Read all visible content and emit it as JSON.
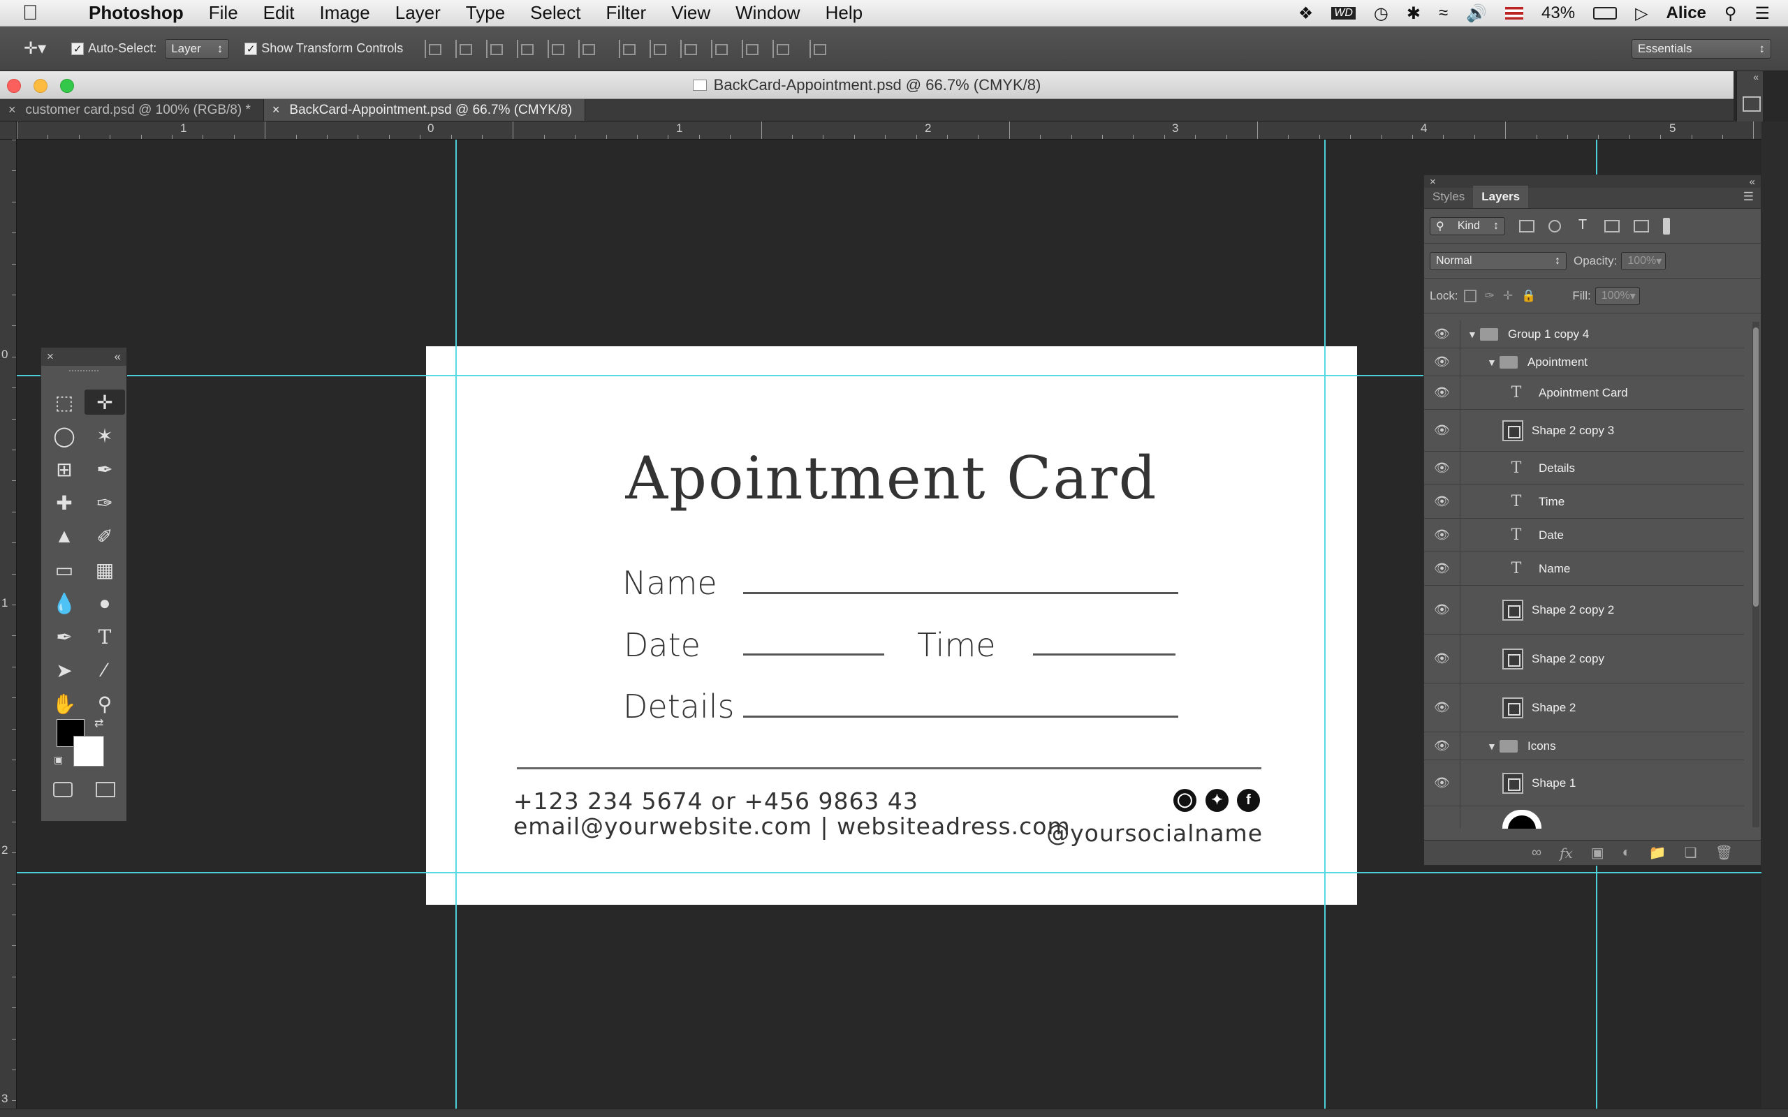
{
  "menubar": {
    "app_name": "Photoshop",
    "items": [
      "File",
      "Edit",
      "Image",
      "Layer",
      "Type",
      "Select",
      "Filter",
      "View",
      "Window",
      "Help"
    ],
    "battery": "43%",
    "user": "Alice"
  },
  "options": {
    "auto_select_label": "Auto-Select:",
    "auto_select_value": "Layer",
    "show_transform_label": "Show Transform Controls",
    "workspace": "Essentials"
  },
  "window": {
    "title": "BackCard-Appointment.psd @ 66.7% (CMYK/8)"
  },
  "tabs": [
    {
      "label": "customer card.psd @ 100% (RGB/8) *"
    },
    {
      "label": "BackCard-Appointment.psd @ 66.7% (CMYK/8)"
    }
  ],
  "ruler": {
    "top_labels": [
      "1",
      "0",
      "1",
      "2",
      "3",
      "4",
      "5"
    ],
    "left_labels": [
      "0",
      "1",
      "2",
      "3"
    ]
  },
  "card": {
    "title": "Apointment Card",
    "name_label": "Name",
    "date_label": "Date",
    "time_label": "Time",
    "details_label": "Details",
    "phone": "+123 234 5674 or +456 9863 43",
    "web": "email@yourwebsite.com | websiteadress.com",
    "social": "@yoursocialname",
    "social_icons": [
      "instagram-icon",
      "twitter-icon",
      "facebook-icon"
    ]
  },
  "layers_panel": {
    "tab_styles": "Styles",
    "tab_layers": "Layers",
    "kind": "Kind",
    "blend_mode": "Normal",
    "opacity_label": "Opacity:",
    "opacity_value": "100%",
    "lock_label": "Lock:",
    "fill_label": "Fill:",
    "fill_value": "100%",
    "layers": [
      {
        "name": "Group 1 copy 4",
        "type": "group",
        "indent": 0
      },
      {
        "name": "Apointment",
        "type": "group",
        "indent": 1
      },
      {
        "name": "Apointment Card",
        "type": "text",
        "indent": 2
      },
      {
        "name": "Shape 2 copy 3",
        "type": "shape",
        "indent": 2
      },
      {
        "name": "Details",
        "type": "text",
        "indent": 2
      },
      {
        "name": "Time",
        "type": "text",
        "indent": 2
      },
      {
        "name": "Date",
        "type": "text",
        "indent": 2
      },
      {
        "name": "Name",
        "type": "text",
        "indent": 2
      },
      {
        "name": "Shape 2 copy 2",
        "type": "shape",
        "indent": 2
      },
      {
        "name": "Shape 2 copy",
        "type": "shape",
        "indent": 2
      },
      {
        "name": "Shape 2",
        "type": "shape",
        "indent": 2
      },
      {
        "name": "Icons",
        "type": "group",
        "indent": 1
      },
      {
        "name": "Shape 1",
        "type": "shape",
        "indent": 2
      }
    ]
  },
  "colors": {
    "guide": "#4fd8e0",
    "canvas_bg": "#282828",
    "panel_bg": "#535353"
  }
}
